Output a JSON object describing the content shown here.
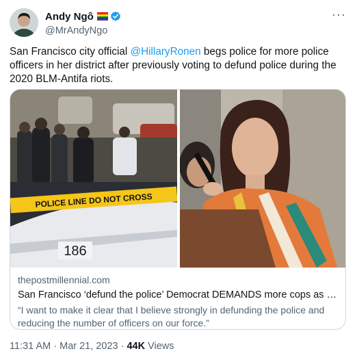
{
  "author": {
    "display_name": "Andy Ngô",
    "handle": "@MrAndyNgo",
    "flag_icon": "rainbow-flag-icon",
    "verified_icon": "verified-badge-icon"
  },
  "tweet": {
    "text_before": "San Francisco city official ",
    "mention": "@HillaryRonen",
    "text_after": " begs police for more police officers in her district after previously voting to defund police during the 2020 BLM-Antifa riots."
  },
  "card": {
    "images": [
      "police-scene-image",
      "speaker-podium-image"
    ],
    "tape_text": "POLICE LINE DO NOT CROSS",
    "car_number": "186",
    "domain": "thepostmillennial.com",
    "title": "San Francisco ‘defund the police’ Democrat DEMANDS more cops as crime s...",
    "description": "“I want to make it clear that I believe strongly in defunding the police and reducing the number of officers on our force.”"
  },
  "meta": {
    "time": "11:31 AM",
    "date": "Mar 21, 2023",
    "separator": "·",
    "views_count": "44K",
    "views_label": "Views"
  },
  "colors": {
    "link": "#1d9bf0",
    "verified": "#1d9bf0",
    "secondary_text": "#536471",
    "border": "#cfd9de"
  }
}
